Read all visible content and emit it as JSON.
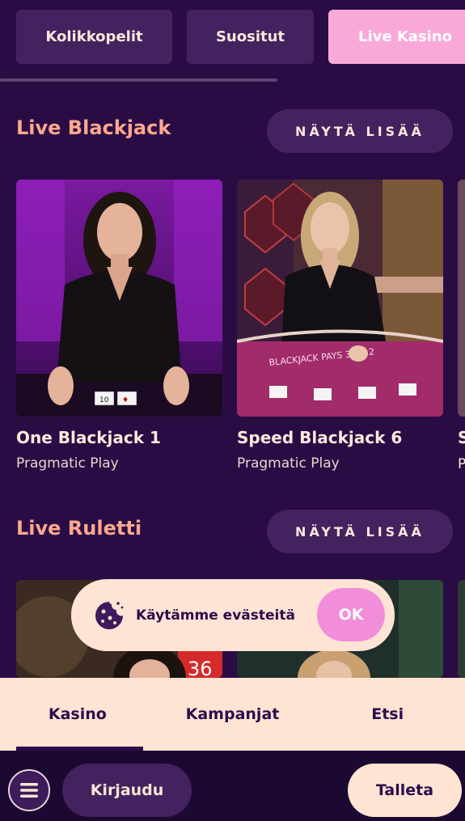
{
  "category_tabs": [
    {
      "label": "Kolikkopelit"
    },
    {
      "label": "Suositut"
    },
    {
      "label": "Live Kasino"
    }
  ],
  "sections": [
    {
      "title": "Live Blackjack",
      "more_label": "NÄYTÄ LISÄÄ",
      "games": [
        {
          "title": "One Blackjack 1",
          "provider": "Pragmatic Play"
        },
        {
          "title": "Speed Blackjack 6",
          "provider": "Pragmatic Play"
        }
      ],
      "peek_title": "S",
      "peek_provider": "P"
    },
    {
      "title": "Live Ruletti",
      "more_label": "NÄYTÄ LISÄÄ"
    }
  ],
  "cookie_banner": {
    "text": "Käytämme evästeitä",
    "ok_label": "OK",
    "icon": "cookie-icon"
  },
  "bottom_tabs": [
    {
      "label": "Kasino",
      "active": true
    },
    {
      "label": "Kampanjat",
      "active": false
    },
    {
      "label": "Etsi",
      "active": false
    }
  ],
  "bottom_bar": {
    "menu_icon": "hamburger-icon",
    "login_label": "Kirjaudu",
    "deposit_label": "Talleta"
  },
  "colors": {
    "background": "#2a0c45",
    "accent_pink": "#f9a9d8",
    "section_title": "#ffa88e",
    "cream": "#ffe4d4"
  }
}
